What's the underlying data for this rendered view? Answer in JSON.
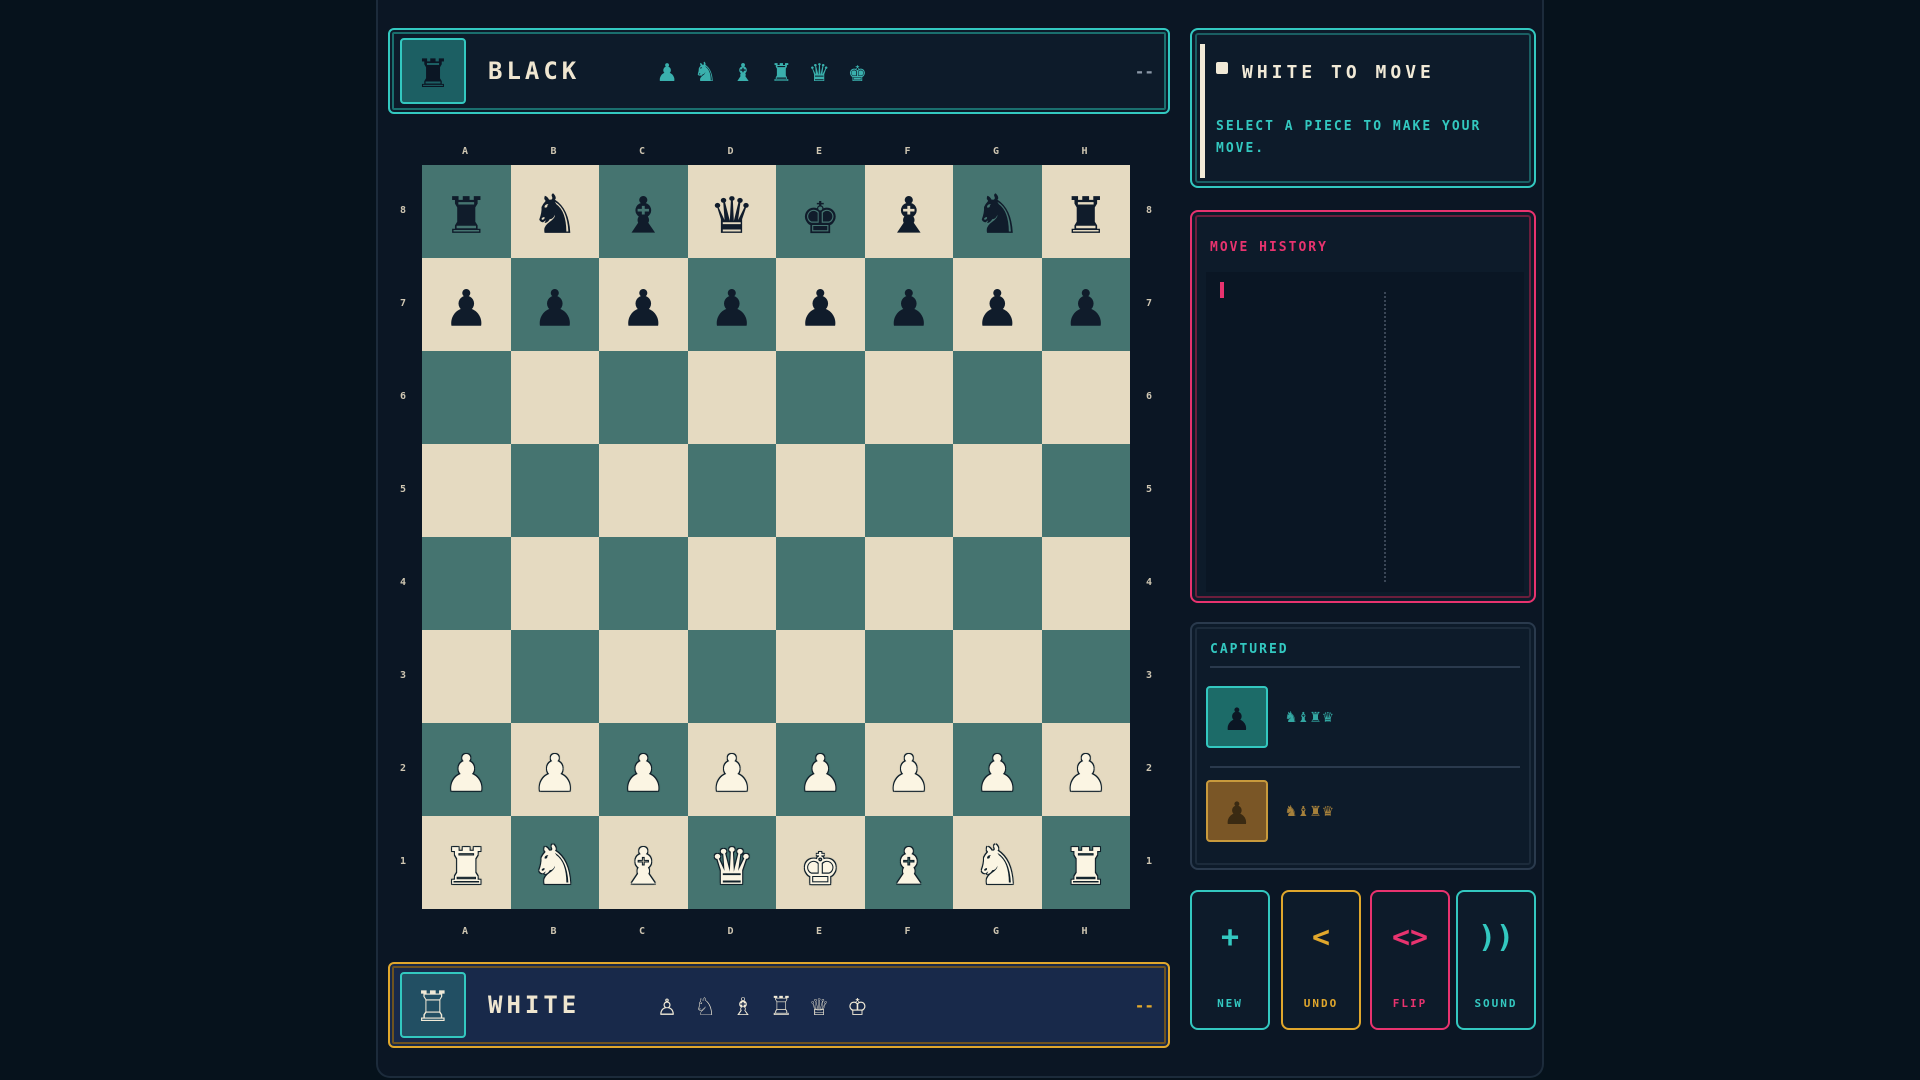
{
  "colors": {
    "accent_teal": "#33c8c0",
    "accent_gold": "#e0a72c",
    "accent_pink": "#e8336f",
    "board_light": "#e5dac1",
    "board_dark": "#457470",
    "background": "#06121c"
  },
  "black_player": {
    "avatar_icon": "rook-icon",
    "avatar_glyph": "♜",
    "name": "BLACK",
    "pieces": [
      "♟",
      "♞",
      "♝",
      "♜",
      "♛",
      "♚"
    ],
    "score": "--"
  },
  "white_player": {
    "avatar_icon": "rook-icon",
    "avatar_glyph": "♖",
    "name": "WHITE",
    "pieces": [
      "♙",
      "♘",
      "♗",
      "♖",
      "♕",
      "♔"
    ],
    "score": "--"
  },
  "board": {
    "files": [
      "a",
      "b",
      "c",
      "d",
      "e",
      "f",
      "g",
      "h"
    ],
    "ranks": [
      "8",
      "7",
      "6",
      "5",
      "4",
      "3",
      "2",
      "1"
    ],
    "position": [
      [
        "r",
        "n",
        "b",
        "q",
        "k",
        "b",
        "n",
        "r"
      ],
      [
        "p",
        "p",
        "p",
        "p",
        "p",
        "p",
        "p",
        "p"
      ],
      [
        "",
        "",
        "",
        "",
        "",
        "",
        "",
        ""
      ],
      [
        "",
        "",
        "",
        "",
        "",
        "",
        "",
        ""
      ],
      [
        "",
        "",
        "",
        "",
        "",
        "",
        "",
        ""
      ],
      [
        "",
        "",
        "",
        "",
        "",
        "",
        "",
        ""
      ],
      [
        "P",
        "P",
        "P",
        "P",
        "P",
        "P",
        "P",
        "P"
      ],
      [
        "R",
        "N",
        "B",
        "Q",
        "K",
        "B",
        "N",
        "R"
      ]
    ]
  },
  "status": {
    "title": "WHITE TO MOVE",
    "message": "SELECT A PIECE TO MAKE YOUR MOVE."
  },
  "history": {
    "title": "MOVE HISTORY",
    "moves": []
  },
  "captured": {
    "title": "CAPTURED",
    "black_icon": "pawn-icon",
    "black_glyph": "♟",
    "black_pieces": "♞♝♜♛",
    "white_icon": "pawn-icon",
    "white_glyph": "♟",
    "white_pieces": "♞♝♜♛"
  },
  "controls": {
    "new": {
      "icon": "plus-icon",
      "glyph": "+",
      "label": "NEW"
    },
    "undo": {
      "icon": "undo-icon",
      "glyph": "<",
      "label": "UNDO"
    },
    "flip": {
      "icon": "flip-icon",
      "glyph": "<>",
      "label": "FLIP"
    },
    "sound": {
      "icon": "sound-icon",
      "glyph": "))",
      "label": "SOUND"
    }
  }
}
